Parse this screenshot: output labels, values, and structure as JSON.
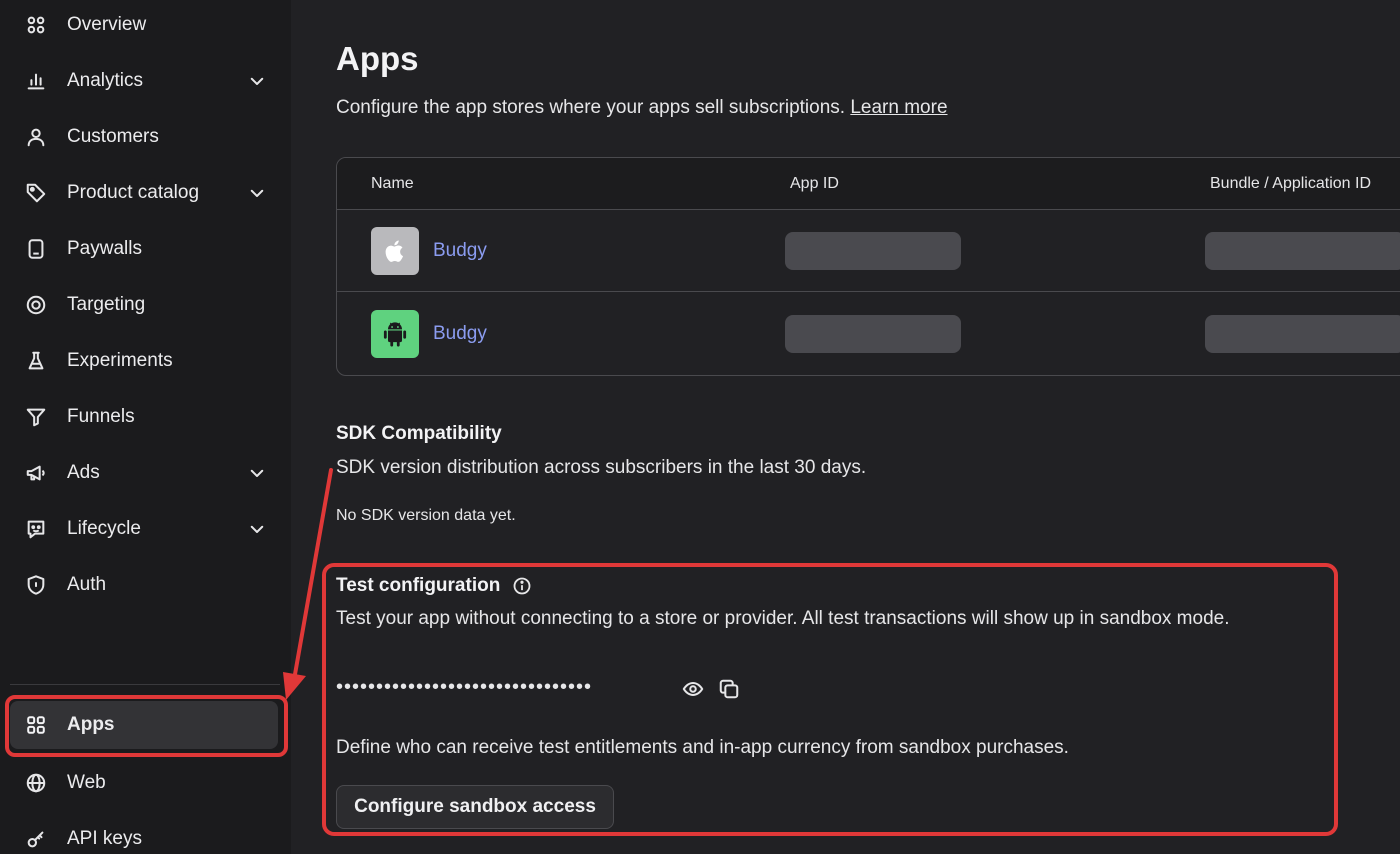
{
  "sidebar": {
    "items": [
      {
        "label": "Overview",
        "icon": "grid-icon"
      },
      {
        "label": "Analytics",
        "icon": "bar-chart-icon",
        "expandable": true
      },
      {
        "label": "Customers",
        "icon": "user-icon"
      },
      {
        "label": "Product catalog",
        "icon": "tag-icon",
        "expandable": true
      },
      {
        "label": "Paywalls",
        "icon": "phone-icon"
      },
      {
        "label": "Targeting",
        "icon": "target-icon"
      },
      {
        "label": "Experiments",
        "icon": "flask-icon"
      },
      {
        "label": "Funnels",
        "icon": "funnel-icon"
      },
      {
        "label": "Ads",
        "icon": "megaphone-icon",
        "expandable": true
      },
      {
        "label": "Lifecycle",
        "icon": "message-icon",
        "expandable": true
      },
      {
        "label": "Auth",
        "icon": "shield-icon"
      }
    ],
    "bottom_items": [
      {
        "label": "Apps",
        "icon": "grid-icon",
        "active": true
      },
      {
        "label": "Web",
        "icon": "globe-icon"
      },
      {
        "label": "API keys",
        "icon": "key-icon"
      }
    ]
  },
  "header": {
    "title": "Apps",
    "subtitle": "Configure the app stores where your apps sell subscriptions.",
    "learn_more": "Learn more"
  },
  "apps_table": {
    "columns": [
      "Name",
      "App ID",
      "Bundle / Application ID"
    ],
    "rows": [
      {
        "platform": "apple-icon",
        "name": "Budgy"
      },
      {
        "platform": "android-icon",
        "name": "Budgy"
      }
    ]
  },
  "sdk": {
    "title": "SDK Compatibility",
    "description": "SDK version distribution across subscribers in the last 30 days.",
    "empty": "No SDK version data yet."
  },
  "test_config": {
    "title": "Test configuration",
    "description": "Test your app without connecting to a store or provider. All test transactions will show up in sandbox mode.",
    "key_masked": "••••••••••••••••••••••••••••••••",
    "sandbox_text": "Define who can receive test entitlements and in-app currency from sandbox purchases.",
    "button": "Configure sandbox access"
  },
  "colors": {
    "accent_link": "#8b9cf0",
    "highlight": "#e03838",
    "apple_bg": "#b9b9bc",
    "android_bg": "#5fd27f"
  }
}
